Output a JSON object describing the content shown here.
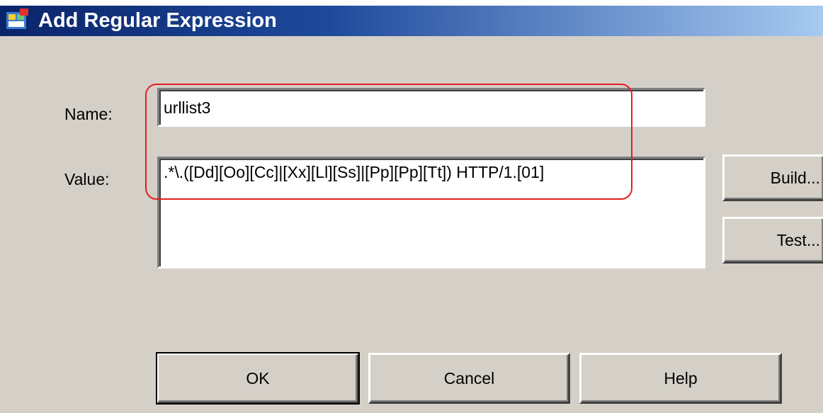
{
  "caption_text": "",
  "window": {
    "title": "Add Regular Expression",
    "icon": "app-icon"
  },
  "form": {
    "name_label": "Name:",
    "name_value": "urllist3",
    "value_label": "Value:",
    "value_value": ".*\\.([Dd][Oo][Cc]|[Xx][Ll][Ss]|[Pp][Pp][Tt]) HTTP/1.[01]"
  },
  "side_buttons": {
    "build_label": "Build...",
    "test_label": "Test..."
  },
  "footer_buttons": {
    "ok_label": "OK",
    "cancel_label": "Cancel",
    "help_label": "Help"
  },
  "colors": {
    "highlight": "#e02020",
    "dialog_bg": "#d4d0c8",
    "titlebar_start": "#0a246a",
    "titlebar_end": "#a6caf0"
  }
}
